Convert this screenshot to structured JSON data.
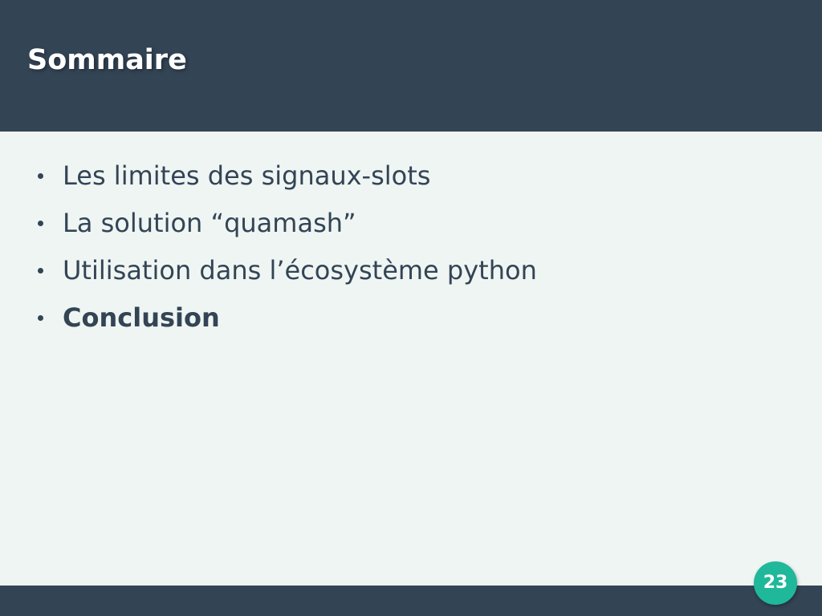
{
  "slide": {
    "title": "Sommaire",
    "page_number": "23",
    "colors": {
      "header_background": "#334455",
      "body_background": "#eff5f3",
      "text": "#334455",
      "accent": "#1fb89a"
    },
    "bullets": [
      {
        "label": "Les limites des signaux-slots",
        "active": false
      },
      {
        "label": "La solution “quamash”",
        "active": false
      },
      {
        "label": "Utilisation dans l’écosystème python",
        "active": false
      },
      {
        "label": "Conclusion",
        "active": true
      }
    ]
  }
}
